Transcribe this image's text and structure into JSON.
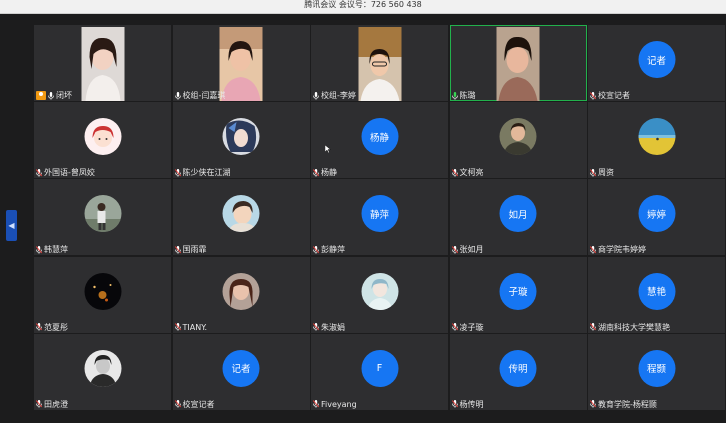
{
  "window": {
    "title": "腾讯会议 会议号：726 560 438"
  },
  "colors": {
    "avatar_blue": "#1676f3",
    "active_speaker_border": "#22b14c",
    "tile_bg": "#2e2e30"
  },
  "participants": [
    {
      "name": "闭坏",
      "kind": "video",
      "host": true
    },
    {
      "name": "校组-闫嘉琪",
      "kind": "video"
    },
    {
      "name": "校组-李婷",
      "kind": "video"
    },
    {
      "name": "陈璐",
      "kind": "video",
      "active": true,
      "mic": "active"
    },
    {
      "name": "校宣记者",
      "kind": "text-avatar",
      "avatar_text": "记者"
    },
    {
      "name": "外国语-曾凤姣",
      "kind": "image-avatar",
      "avatar_icon": "cartoon-girl-icon"
    },
    {
      "name": "陈少侠在江湖",
      "kind": "image-avatar",
      "avatar_icon": "anime-portrait-icon"
    },
    {
      "name": "杨静",
      "kind": "text-avatar",
      "avatar_text": "杨静"
    },
    {
      "name": "文柯亮",
      "kind": "image-avatar",
      "avatar_icon": "man-photo-icon"
    },
    {
      "name": "周资",
      "kind": "image-avatar",
      "avatar_icon": "seascape-icon"
    },
    {
      "name": "韩慧萍",
      "kind": "image-avatar",
      "avatar_icon": "outdoor-person-icon"
    },
    {
      "name": "国雨霏",
      "kind": "image-avatar",
      "avatar_icon": "cartoon-boy-icon"
    },
    {
      "name": "彭静萍",
      "kind": "text-avatar",
      "avatar_text": "静萍"
    },
    {
      "name": "张如月",
      "kind": "text-avatar",
      "avatar_text": "如月"
    },
    {
      "name": "商学院韦婷婷",
      "kind": "text-avatar",
      "avatar_text": "婷婷"
    },
    {
      "name": "范夏彤",
      "kind": "image-avatar",
      "avatar_icon": "night-lights-icon"
    },
    {
      "name": "TIANY.",
      "kind": "image-avatar",
      "avatar_icon": "girl-photo-icon"
    },
    {
      "name": "朱淑娟",
      "kind": "image-avatar",
      "avatar_icon": "pastel-drawing-icon"
    },
    {
      "name": "凌子璇",
      "kind": "text-avatar",
      "avatar_text": "子璇"
    },
    {
      "name": "湖南科技大学樊慧艳",
      "kind": "text-avatar",
      "avatar_text": "慧艳"
    },
    {
      "name": "田虎澄",
      "kind": "image-avatar",
      "avatar_icon": "bw-portrait-icon"
    },
    {
      "name": "校宣记者",
      "kind": "text-avatar",
      "avatar_text": "记者"
    },
    {
      "name": "Fiveyang",
      "kind": "text-avatar",
      "avatar_text": "F"
    },
    {
      "name": "杨传明",
      "kind": "text-avatar",
      "avatar_text": "传明"
    },
    {
      "name": "教育学院-杨程颢",
      "kind": "text-avatar",
      "avatar_text": "程颢"
    }
  ]
}
